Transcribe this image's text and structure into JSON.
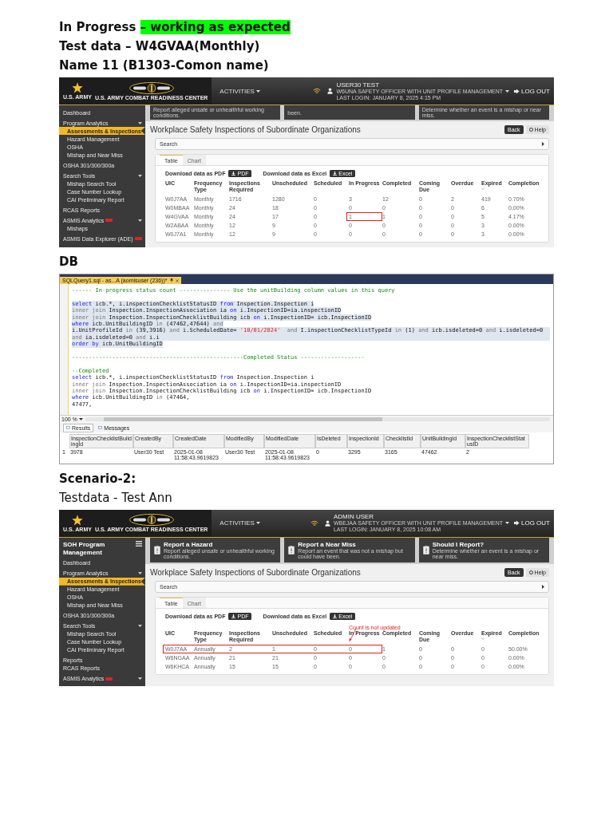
{
  "document": [
    {
      "kind": "heading",
      "text": "In Progress ",
      "highlighted": "– working as expected",
      "bold": true
    },
    {
      "kind": "heading",
      "text": "Test data – W4GVAA(Monthly)",
      "bold": true
    },
    {
      "kind": "heading",
      "text": "Name 11 (B1303-Comon name)",
      "bold": true
    },
    {
      "kind": "app_screenshot",
      "header": {
        "logo_text": [
          "U.S. ARMY",
          "U.S. ARMY COMBAT READINESS CENTER"
        ],
        "menu": "ACTIVITIES",
        "user_name": "USER30 TEST",
        "user_role": "W6UNA SAFETY OFFICER WITH UNIT PROFILE MANAGEMENT",
        "last_login": "LAST LOGIN: JANUARY 8, 2025 4:15 PM",
        "logout": "LOG OUT"
      },
      "banner": [
        {
          "description": "Report alleged unsafe or unhealthful working conditions."
        },
        {
          "description": "been."
        },
        {
          "description": "Determine whether an event is a mishap or near miss."
        }
      ],
      "sidebar": {
        "items": [
          {
            "label": "Dashboard",
            "kind": "link",
            "selected": false,
            "badge": false
          },
          {
            "label": "Program Analytics",
            "kind": "group",
            "selected": false,
            "badge": false,
            "children": [
              {
                "label": "Assessments & Inspections",
                "selected": true
              },
              {
                "label": "Hazard Management",
                "selected": false
              },
              {
                "label": "OSHA",
                "selected": false
              },
              {
                "label": "Mishap and Near Miss",
                "selected": false
              }
            ]
          },
          {
            "label": "OSHA 301/300/300a",
            "kind": "link",
            "selected": false,
            "badge": false
          },
          {
            "label": "Search Tools",
            "kind": "group",
            "selected": false,
            "badge": false,
            "children": [
              {
                "label": "Mishap Search Tool",
                "selected": false
              },
              {
                "label": "Case Number Lookup",
                "selected": false
              },
              {
                "label": "CAI Preliminary Report",
                "selected": false
              }
            ]
          },
          {
            "label": "RCAS Reports",
            "kind": "link",
            "selected": false,
            "badge": false
          },
          {
            "label": "ASMIS Analytics",
            "kind": "group",
            "selected": false,
            "badge": true,
            "children": [
              {
                "label": "Mishaps",
                "selected": false
              }
            ]
          },
          {
            "label": "ASMIS Data Explorer (ADE)",
            "kind": "link",
            "selected": false,
            "badge": true
          }
        ]
      },
      "page_title": "Workplace Safety Inspections of Subordinate Organizations",
      "back_button": "Back",
      "help_button": "Help",
      "search": "Search",
      "tabs": [
        {
          "label": "Table",
          "selected": true
        },
        {
          "label": "Chart",
          "selected": false
        }
      ],
      "downloads": [
        {
          "label": "Download data as PDF",
          "button": "PDF"
        },
        {
          "label": "Download data as Excel",
          "button": "Excel"
        }
      ],
      "table": {
        "columns": [
          {
            "label": "UIC",
            "sorted": false
          },
          {
            "label": "Frequency Type",
            "sorted": false
          },
          {
            "label": "Inspections Required",
            "sorted": false
          },
          {
            "label": "Unscheduled",
            "sorted": false
          },
          {
            "label": "Scheduled",
            "sorted": false
          },
          {
            "label": "In Progress",
            "sorted": false
          },
          {
            "label": "Completed",
            "sorted": false
          },
          {
            "label": "Coming Due",
            "sorted": false
          },
          {
            "label": "Overdue",
            "sorted": false
          },
          {
            "label": "Expired",
            "sorted": true
          },
          {
            "label": "Completion",
            "sorted": false
          }
        ],
        "rows": [
          {
            "cells": [
              "W0J7AA",
              "Monthly",
              "1716",
              "1280",
              "0",
              "3",
              "12",
              "0",
              "2",
              "419",
              "0.70%"
            ],
            "outlined": [
              false,
              false,
              false,
              false,
              false,
              false,
              false,
              false,
              false,
              false,
              false
            ]
          },
          {
            "cells": [
              "W0MBAA",
              "Monthly",
              "24",
              "18",
              "0",
              "0",
              "0",
              "0",
              "0",
              "6",
              "0.00%"
            ],
            "outlined": [
              false,
              false,
              false,
              false,
              false,
              false,
              false,
              false,
              false,
              false,
              false
            ]
          },
          {
            "cells": [
              "W4GVAA",
              "Monthly",
              "24",
              "17",
              "0",
              "1",
              "1",
              "0",
              "0",
              "5",
              "4.17%"
            ],
            "outlined": [
              false,
              false,
              false,
              false,
              false,
              true,
              false,
              false,
              false,
              false,
              false
            ]
          },
          {
            "cells": [
              "W2ABAA",
              "Monthly",
              "12",
              "9",
              "0",
              "0",
              "0",
              "0",
              "0",
              "3",
              "0.00%"
            ],
            "outlined": [
              false,
              false,
              false,
              false,
              false,
              false,
              false,
              false,
              false,
              false,
              false
            ]
          },
          {
            "cells": [
              "W0J7A1",
              "Monthly",
              "12",
              "9",
              "0",
              "0",
              "0",
              "0",
              "0",
              "3",
              "0.00%"
            ],
            "outlined": [
              false,
              false,
              false,
              false,
              false,
              false,
              false,
              false,
              false,
              false,
              false
            ]
          }
        ]
      }
    },
    {
      "kind": "heading",
      "text": "DB",
      "bold": true
    },
    {
      "kind": "sql_screenshot",
      "tab": "SQLQuery1.sql - as...A (aomisuser (236))*",
      "blocks": [
        {
          "selected": false,
          "lines": [
            [
              {
                "kind": "comment",
                "text": "------ In-progress status count --------------- Use the unitBuilding column values in this query"
              }
            ]
          ]
        },
        {
          "selected": true,
          "lines": [
            [
              {
                "kind": "keyword",
                "text": "select"
              },
              {
                "kind": "plain",
                "text": " icb.*, i.inspectionChecklistStatusID "
              },
              {
                "kind": "keyword",
                "text": "from"
              },
              {
                "kind": "plain",
                "text": " Inspection.Inspection i"
              }
            ],
            [
              {
                "kind": "operator",
                "text": "inner join"
              },
              {
                "kind": "plain",
                "text": " Inspection.InspectionAssociation ia "
              },
              {
                "kind": "keyword",
                "text": "on"
              },
              {
                "kind": "plain",
                "text": " i.InspectionID=ia.inspectionID"
              }
            ],
            [
              {
                "kind": "operator",
                "text": "inner join"
              },
              {
                "kind": "plain",
                "text": " Inspection.InspectionChecklistBuilding icb "
              },
              {
                "kind": "keyword",
                "text": "on"
              },
              {
                "kind": "plain",
                "text": " i.InspectionID= icb.InspectionID"
              }
            ],
            [
              {
                "kind": "keyword",
                "text": "where"
              },
              {
                "kind": "plain",
                "text": " icb.UnitBuildingID "
              },
              {
                "kind": "operator",
                "text": "in"
              },
              {
                "kind": "plain",
                "text": " (47462,47644) "
              },
              {
                "kind": "operator",
                "text": "and"
              }
            ],
            [
              {
                "kind": "plain",
                "text": "i.UnitProfileId "
              },
              {
                "kind": "operator",
                "text": "in"
              },
              {
                "kind": "plain",
                "text": " (39,3916) "
              },
              {
                "kind": "operator",
                "text": "and"
              },
              {
                "kind": "plain",
                "text": " i.ScheduledDate= "
              },
              {
                "kind": "string",
                "text": "'10/01/2024'"
              },
              {
                "kind": "operator",
                "text": "  and"
              },
              {
                "kind": "plain",
                "text": " I.inspectionChecklistTypeId "
              },
              {
                "kind": "operator",
                "text": "in"
              },
              {
                "kind": "plain",
                "text": " (1) "
              },
              {
                "kind": "operator",
                "text": "and"
              },
              {
                "kind": "plain",
                "text": " icb.isdeleted=0 "
              },
              {
                "kind": "operator",
                "text": "and"
              },
              {
                "kind": "plain",
                "text": " i.isdeleted=0 "
              },
              {
                "kind": "operator",
                "text": "and"
              },
              {
                "kind": "plain",
                "text": " ia.isdeleted=0 "
              },
              {
                "kind": "operator",
                "text": "and"
              },
              {
                "kind": "plain",
                "text": " i.i"
              }
            ],
            [
              {
                "kind": "keyword",
                "text": "order by"
              },
              {
                "kind": "plain",
                "text": " icb.UnitBuildingID"
              }
            ]
          ]
        },
        {
          "selected": false,
          "lines": [
            [
              {
                "kind": "comment",
                "text": "---------------------------------------------------Completed Status -------------------"
              }
            ]
          ]
        },
        {
          "selected": false,
          "lines": [
            [
              {
                "kind": "comment",
                "text": "--Completed"
              }
            ],
            [
              {
                "kind": "keyword",
                "text": "select"
              },
              {
                "kind": "plain",
                "text": " icb.*, i.inspectionChecklistStatusID "
              },
              {
                "kind": "keyword",
                "text": "from"
              },
              {
                "kind": "plain",
                "text": " Inspection.Inspection i"
              }
            ],
            [
              {
                "kind": "operator",
                "text": "inner join"
              },
              {
                "kind": "plain",
                "text": " Inspection.InspectionAssociation ia "
              },
              {
                "kind": "keyword",
                "text": "on"
              },
              {
                "kind": "plain",
                "text": " i.InspectionID=ia.inspectionID"
              }
            ],
            [
              {
                "kind": "operator",
                "text": "inner join"
              },
              {
                "kind": "plain",
                "text": " Inspection.InspectionChecklistBuilding icb "
              },
              {
                "kind": "keyword",
                "text": "on"
              },
              {
                "kind": "plain",
                "text": " i.InspectionID= icb.InspectionID"
              }
            ],
            [
              {
                "kind": "keyword",
                "text": "where"
              },
              {
                "kind": "plain",
                "text": " icb.UnitBuildingID "
              },
              {
                "kind": "operator",
                "text": "in"
              },
              {
                "kind": "plain",
                "text": " (47464,"
              }
            ],
            [
              {
                "kind": "plain",
                "text": "47477,"
              }
            ]
          ]
        }
      ],
      "zoom": "100 %",
      "result_tabs": [
        {
          "label": "Results",
          "selected": true
        },
        {
          "label": "Messages",
          "selected": false
        }
      ],
      "results": {
        "columns": [
          "InspectionChecklistBuildingId",
          "CreatedBy",
          "CreatedDate",
          "ModifiedBy",
          "ModifiedDate",
          "IsDeleted",
          "InspectionId",
          "ChecklistId",
          "UnitBuildingId",
          "InspectionChecklistStatusID"
        ],
        "rows": [
          {
            "number": "1",
            "cells": [
              "3978",
              "User30 Test",
              "2025-01-08 11:58:43.9619823",
              "User30 Test",
              "2025-01-08 11:58:43.9619823",
              "0",
              "3295",
              "3165",
              "47462",
              "2"
            ]
          }
        ]
      }
    },
    {
      "kind": "heading",
      "text": "Scenario-2:",
      "bold": true
    },
    {
      "kind": "heading",
      "text": "Testdata - Test Ann",
      "bold": false
    },
    {
      "kind": "app_screenshot",
      "header": {
        "logo_text": [
          "U.S. ARMY",
          "U.S. ARMY COMBAT READINESS CENTER"
        ],
        "menu": "ACTIVITIES",
        "user_name": "ADMIN USER",
        "user_role": "WBEJAA SAFETY OFFICER WITH UNIT PROFILE MANAGEMENT",
        "last_login": "LAST LOGIN: JANUARY 8, 2025 10:08 AM",
        "logout": "LOG OUT"
      },
      "banner": [
        {
          "title": "Report a Hazard",
          "description": "Report alleged unsafe or unhealthful working conditions."
        },
        {
          "title": "Report a Near Miss",
          "description": "Report an event that was not a mishap but could have been."
        },
        {
          "title": "Should I Report?",
          "description": "Determine whether an event is a mishap or near miss."
        }
      ],
      "sidebar": {
        "title": "SOH Program Management",
        "items": [
          {
            "label": "Dashboard",
            "kind": "link",
            "selected": false,
            "badge": false
          },
          {
            "label": "Program Analytics",
            "kind": "group",
            "selected": false,
            "badge": false,
            "children": [
              {
                "label": "Assessments & Inspections",
                "selected": true
              },
              {
                "label": "Hazard Management",
                "selected": false
              },
              {
                "label": "OSHA",
                "selected": false
              },
              {
                "label": "Mishap and Near Miss",
                "selected": false
              }
            ]
          },
          {
            "label": "OSHA 301/300/300a",
            "kind": "link",
            "selected": false,
            "badge": false
          },
          {
            "label": "Search Tools",
            "kind": "group",
            "selected": false,
            "badge": false,
            "children": [
              {
                "label": "Mishap Search Tool",
                "selected": false
              },
              {
                "label": "Case Number Lookup",
                "selected": false
              },
              {
                "label": "CAI Preliminary Report",
                "selected": false
              }
            ]
          },
          {
            "label": "Reports",
            "kind": "link",
            "selected": false,
            "badge": false
          },
          {
            "label": "RCAS Reports",
            "kind": "link",
            "selected": false,
            "badge": false
          },
          {
            "label": "ASMIS Analytics",
            "kind": "group",
            "selected": false,
            "badge": true
          }
        ]
      },
      "page_title": "Workplace Safety Inspections of Subordinate Organizations",
      "back_button": "Back",
      "help_button": "Help",
      "search": "Search",
      "tabs": [
        {
          "label": "Table",
          "selected": true
        },
        {
          "label": "Chart",
          "selected": false
        }
      ],
      "downloads": [
        {
          "label": "Download data as PDF",
          "button": "PDF"
        },
        {
          "label": "Download data as Excel",
          "button": "Excel"
        }
      ],
      "table": {
        "annotation": "Count is not updated",
        "columns": [
          {
            "label": "UIC",
            "sorted": false
          },
          {
            "label": "Frequency Type",
            "sorted": false
          },
          {
            "label": "Inspections Required",
            "sorted": false
          },
          {
            "label": "Unscheduled",
            "sorted": false
          },
          {
            "label": "Scheduled",
            "sorted": false
          },
          {
            "label": "In Progress",
            "sorted": false
          },
          {
            "label": "Completed",
            "sorted": false
          },
          {
            "label": "Coming Due",
            "sorted": false
          },
          {
            "label": "Overdue",
            "sorted": false
          },
          {
            "label": "Expired",
            "sorted": true
          },
          {
            "label": "Completion",
            "sorted": false
          }
        ],
        "rows": [
          {
            "cells": [
              "W0J7AA",
              "Annually",
              "2",
              "1",
              "0",
              "0",
              "1",
              "0",
              "0",
              "0",
              "50.00%"
            ],
            "outlined": [
              true,
              true,
              true,
              true,
              true,
              true,
              false,
              false,
              false,
              false,
              false
            ]
          },
          {
            "cells": [
              "W6NGAA",
              "Annually",
              "21",
              "21",
              "0",
              "0",
              "0",
              "0",
              "0",
              "0",
              "0.00%"
            ],
            "outlined": [
              false,
              false,
              false,
              false,
              false,
              false,
              false,
              false,
              false,
              false,
              false
            ]
          },
          {
            "cells": [
              "W6KHCA",
              "Annually",
              "15",
              "15",
              "0",
              "0",
              "0",
              "0",
              "0",
              "0",
              "0.00%"
            ],
            "outlined": [
              false,
              false,
              false,
              false,
              false,
              false,
              false,
              false,
              false,
              false,
              false
            ]
          }
        ]
      }
    }
  ]
}
